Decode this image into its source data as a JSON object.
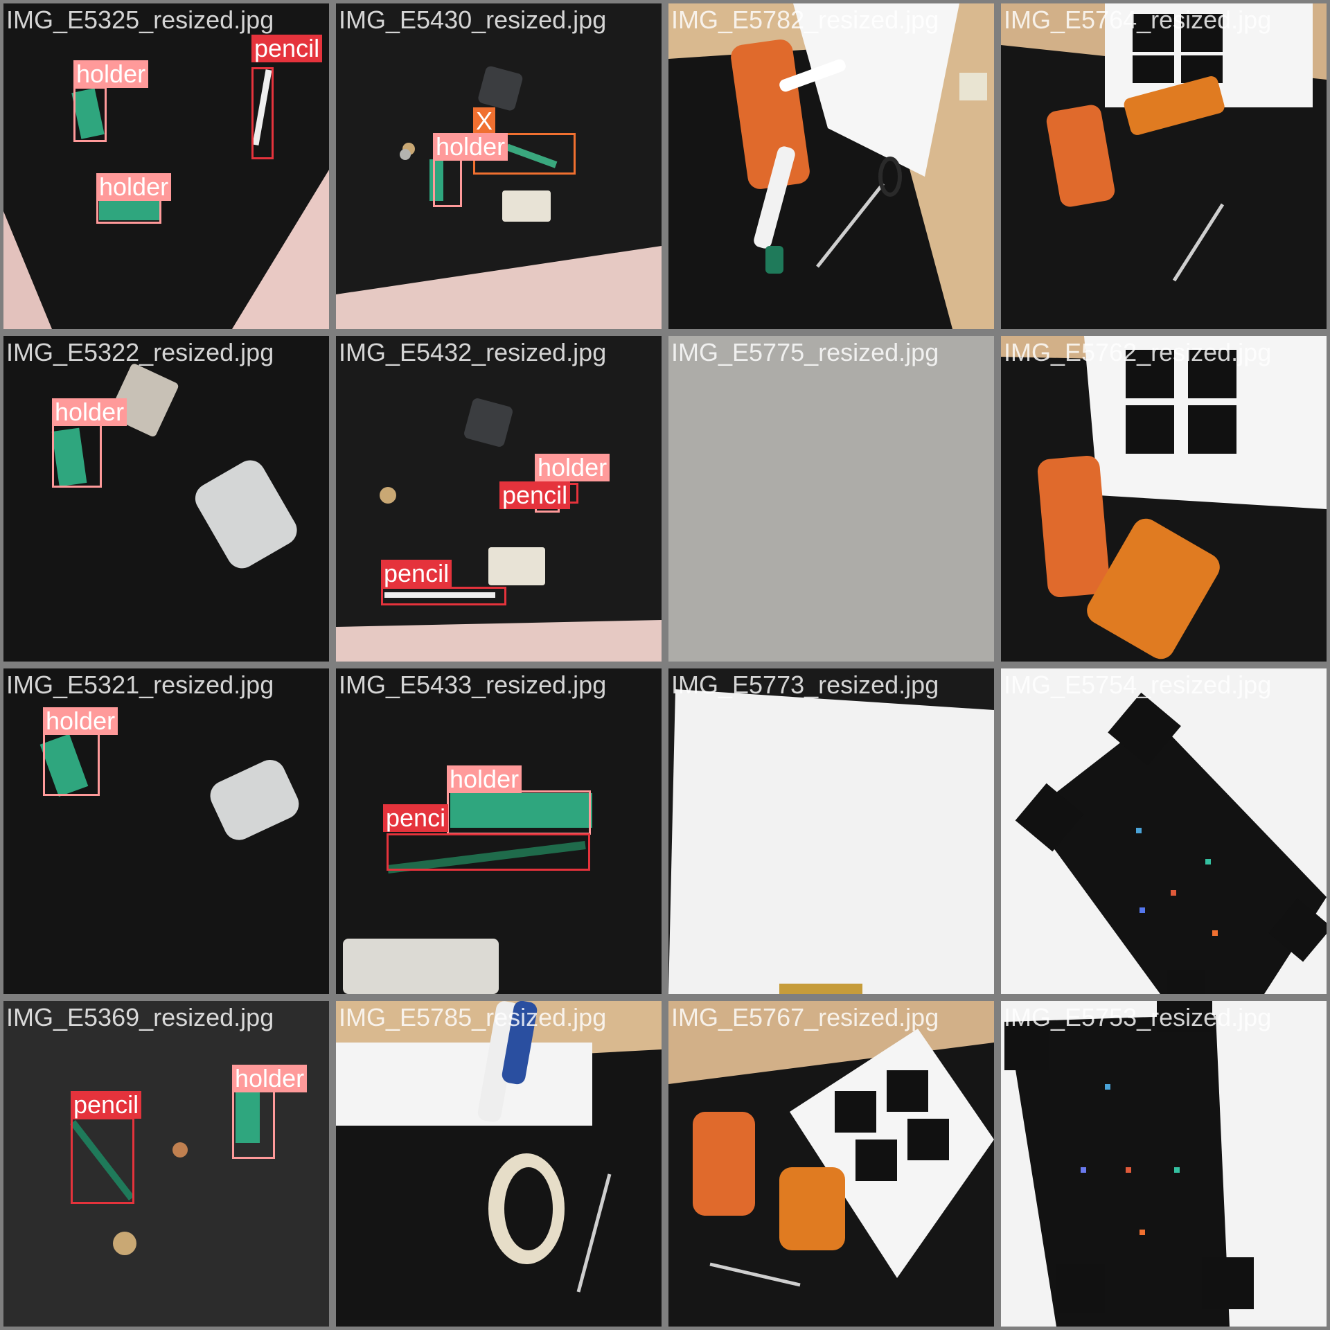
{
  "tiles": [
    {
      "file": "IMG_E5325_resized.jpg",
      "labels": [
        {
          "name": "pencil",
          "cls": "pencil"
        },
        {
          "name": "holder",
          "cls": "holder"
        },
        {
          "name": "holder",
          "cls": "holder"
        }
      ]
    },
    {
      "file": "IMG_E5430_resized.jpg",
      "labels": [
        {
          "name": "X",
          "cls": "x"
        },
        {
          "name": "holder",
          "cls": "holder"
        }
      ]
    },
    {
      "file": "IMG_E5782_resized.jpg",
      "labels": []
    },
    {
      "file": "IMG_E5764_resized.jpg",
      "labels": []
    },
    {
      "file": "IMG_E5322_resized.jpg",
      "labels": [
        {
          "name": "holder",
          "cls": "holder"
        }
      ]
    },
    {
      "file": "IMG_E5432_resized.jpg",
      "labels": [
        {
          "name": "holder",
          "cls": "holder"
        },
        {
          "name": "pencil",
          "cls": "pencil"
        },
        {
          "name": "pencil",
          "cls": "pencil"
        }
      ]
    },
    {
      "file": "IMG_E5775_resized.jpg",
      "labels": []
    },
    {
      "file": "IMG_E5762_resized.jpg",
      "labels": []
    },
    {
      "file": "IMG_E5321_resized.jpg",
      "labels": [
        {
          "name": "holder",
          "cls": "holder"
        }
      ]
    },
    {
      "file": "IMG_E5433_resized.jpg",
      "labels": [
        {
          "name": "holder",
          "cls": "holder"
        },
        {
          "name": "penci",
          "cls": "pencil"
        }
      ]
    },
    {
      "file": "IMG_E5773_resized.jpg",
      "labels": []
    },
    {
      "file": "IMG_E5754_resized.jpg",
      "labels": []
    },
    {
      "file": "IMG_E5369_resized.jpg",
      "labels": [
        {
          "name": "pencil",
          "cls": "pencil"
        },
        {
          "name": "holder",
          "cls": "holder"
        }
      ]
    },
    {
      "file": "IMG_E5785_resized.jpg",
      "labels": []
    },
    {
      "file": "IMG_E5767_resized.jpg",
      "labels": []
    },
    {
      "file": "IMG_E5753_resized.jpg",
      "labels": []
    }
  ]
}
